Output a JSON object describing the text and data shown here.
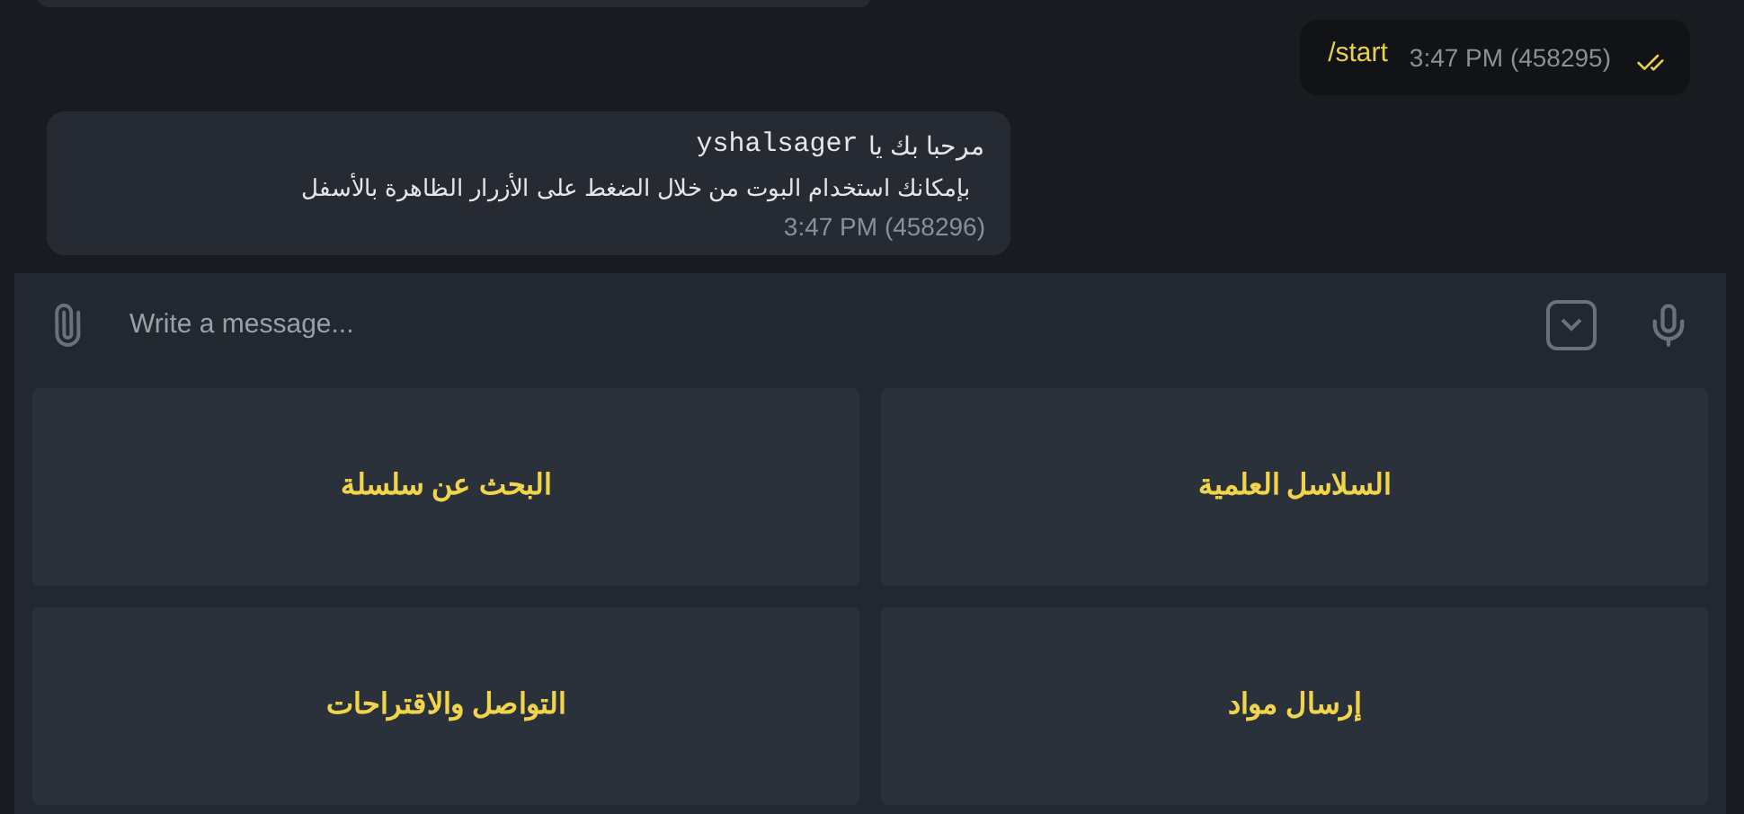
{
  "messages": [
    {
      "kind": "outgoing",
      "text": "/start",
      "time": "3:47 PM (458295)",
      "read": true
    },
    {
      "kind": "incoming",
      "greeting": "مرحبا بك يا",
      "username": "yshalsager",
      "text": "بإمكانك استخدام البوت من خلال الضغط على الأزرار الظاهرة بالأسفل",
      "time": "3:47 PM (458296)"
    }
  ],
  "composer": {
    "placeholder": "Write a message..."
  },
  "keyboard": [
    [
      "السلاسل العلمية",
      "البحث عن سلسلة"
    ],
    [
      "إرسال مواد",
      "التواصل والاقتراحات"
    ]
  ]
}
